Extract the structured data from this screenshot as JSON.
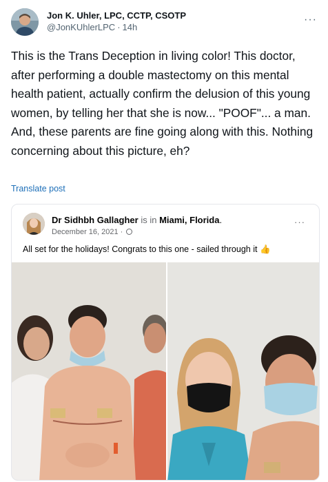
{
  "post": {
    "author_name": "Jon K. Uhler, LPC, CCTP, CSOTP",
    "author_handle": "@JonKUhlerLPC",
    "timestamp": "14h",
    "more_label": "···",
    "text": "This is the Trans Deception in living color!  This doctor, after performing a double mastectomy on this mental health patient, actually confirm the delusion of this young women, by telling her that she is now... \"POOF\"... a man. And, these parents are fine going along with this. Nothing concerning about this picture, eh?",
    "translate_label": "Translate post"
  },
  "embed": {
    "author_name": "Dr Sidhbh Gallagher",
    "is_in": "is in",
    "location": "Miami, Florida",
    "date": "December 16, 2021 ·",
    "more_label": "···",
    "text": "All set for the holidays! Congrats to this one - sailed through it",
    "emoji": "👍"
  },
  "icons": {
    "globe": "globe-icon",
    "more": "more-horizontal-icon"
  }
}
